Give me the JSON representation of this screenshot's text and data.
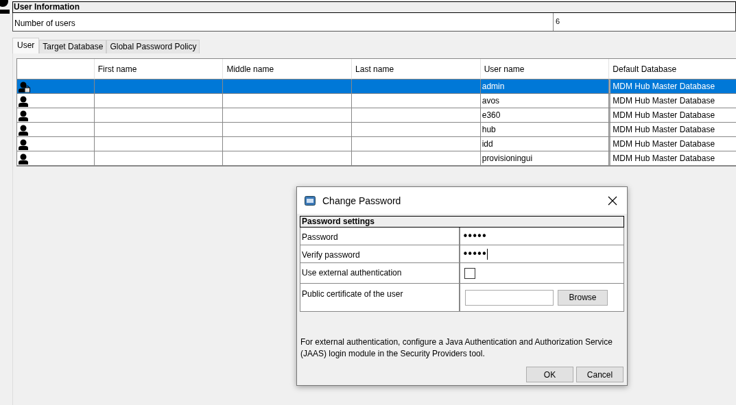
{
  "user_information": {
    "title": "User Information",
    "fields": [
      {
        "label": "Number of users",
        "value": "6"
      }
    ]
  },
  "tabs": [
    {
      "label": "User",
      "selected": true
    },
    {
      "label": "Target Database",
      "selected": false
    },
    {
      "label": "Global Password Policy",
      "selected": false
    }
  ],
  "table": {
    "columns": [
      "First name",
      "Middle name",
      "Last name",
      "User name",
      "Default Database"
    ],
    "rows": [
      {
        "locked": true,
        "selected": true,
        "user_name": "admin",
        "default_database": "MDM Hub Master Database"
      },
      {
        "locked": false,
        "selected": false,
        "user_name": "avos",
        "default_database": "MDM Hub Master Database"
      },
      {
        "locked": false,
        "selected": false,
        "user_name": "e360",
        "default_database": "MDM Hub Master Database"
      },
      {
        "locked": false,
        "selected": false,
        "user_name": "hub",
        "default_database": "MDM Hub Master Database"
      },
      {
        "locked": false,
        "selected": false,
        "user_name": "idd",
        "default_database": "MDM Hub Master Database"
      },
      {
        "locked": false,
        "selected": false,
        "user_name": "provisioningui",
        "default_database": "MDM Hub Master Database"
      }
    ]
  },
  "dialog": {
    "title": "Change Password",
    "section": "Password settings",
    "rows": [
      {
        "kind": "password",
        "label": "Password",
        "value": "•••••",
        "focused": false
      },
      {
        "kind": "password",
        "label": "Verify password",
        "value": "•••••",
        "focused": true
      },
      {
        "kind": "checkbox",
        "label": "Use external authentication",
        "checked": false
      },
      {
        "kind": "file",
        "label": "Public certificate of the user",
        "button": "Browse"
      }
    ],
    "note": "For external authentication, configure a Java Authentication and Authorization Service (JAAS) login module in the Security Providers tool.",
    "buttons": [
      "OK",
      "Cancel"
    ]
  }
}
